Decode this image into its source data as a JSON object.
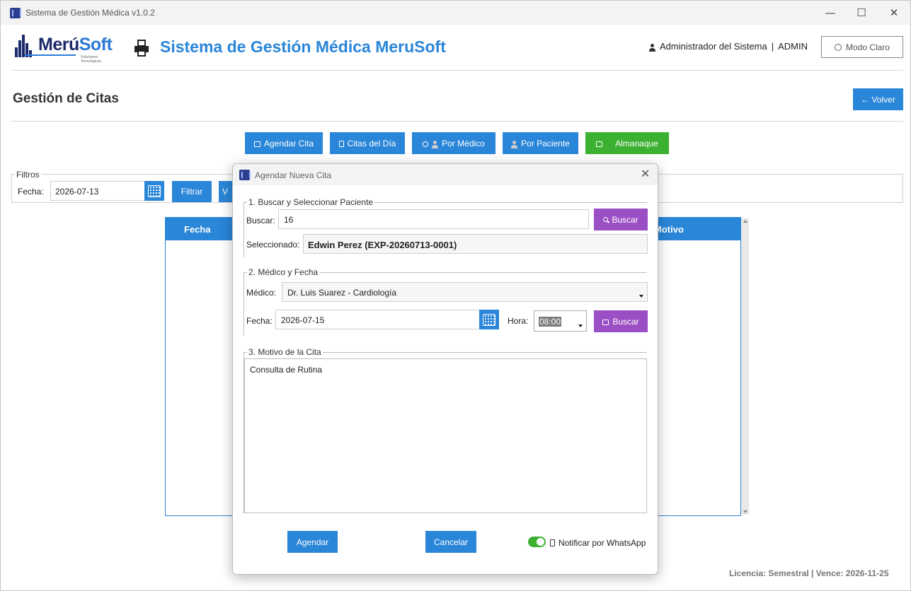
{
  "window": {
    "title": "Sistema de Gestión Médica v1.0.2",
    "controls": {
      "minimize": "—",
      "maximize": "☐",
      "close": "✕"
    }
  },
  "header": {
    "logo_main": "Merú",
    "logo_accent": "Soft",
    "logo_tagline": "Soluciones Tecnológicas",
    "app_title": "Sistema de Gestión Médica MeruSoft",
    "user_name": "Administrador del Sistema",
    "separator": "|",
    "user_role": "ADMIN",
    "mode_button": "Modo Claro"
  },
  "page": {
    "title": "Gestión de Citas",
    "back_button": "← Volver"
  },
  "nav": {
    "agendar": "Agendar Cita",
    "citas_dia": "Citas del Día",
    "por_medico": "Por Médico",
    "por_paciente": "Por Paciente",
    "almanaque": "Almanaque"
  },
  "filters": {
    "legend": "Filtros",
    "fecha_label": "Fecha:",
    "fecha_value": "2026-07-13",
    "filtrar": "Filtrar",
    "ver_partial": "V"
  },
  "table": {
    "columns": [
      "Fecha",
      "Motivo"
    ]
  },
  "footer": {
    "license": "Licencia: Semestral  |  Vence: 2026-11-25"
  },
  "modal": {
    "title": "Agendar Nueva Cita",
    "close": "✕",
    "section1": {
      "legend": "1. Buscar y Seleccionar Paciente",
      "buscar_label": "Buscar:",
      "buscar_value": "16",
      "buscar_button": "Buscar",
      "seleccionado_label": "Seleccionado:",
      "seleccionado_value": "Edwin Perez (EXP-20260713-0001)"
    },
    "section2": {
      "legend": "2. Médico y Fecha",
      "medico_label": "Médico:",
      "medico_value": "Dr. Luis Suarez - Cardiología",
      "fecha_label": "Fecha:",
      "fecha_value": "2026-07-15",
      "hora_label": "Hora:",
      "hora_value": "08:00",
      "buscar_button": "Buscar"
    },
    "section3": {
      "legend": "3. Motivo de la Cita",
      "motivo_value": "Consulta de Rutina"
    },
    "agendar_button": "Agendar",
    "cancelar_button": "Cancelar",
    "whatsapp_label": "Notificar por WhatsApp",
    "whatsapp_on": true
  },
  "colors": {
    "primary": "#2a86d8",
    "green": "#3cb030",
    "purple": "#9b4fc4",
    "logo_dark": "#1c2a6b"
  }
}
